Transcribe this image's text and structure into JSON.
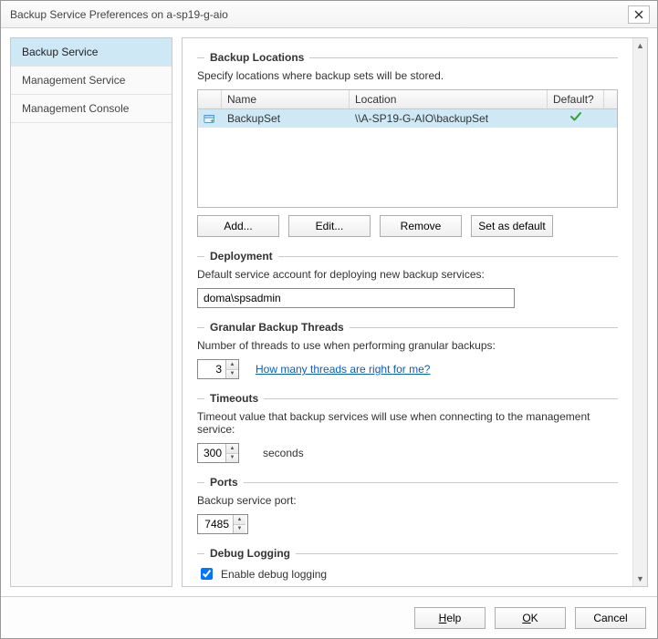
{
  "window": {
    "title": "Backup Service Preferences on a-sp19-g-aio"
  },
  "sidebar": {
    "items": [
      {
        "label": "Backup Service",
        "selected": true
      },
      {
        "label": "Management Service",
        "selected": false
      },
      {
        "label": "Management Console",
        "selected": false
      }
    ]
  },
  "sections": {
    "backup_locations": {
      "title": "Backup Locations",
      "desc": "Specify locations where backup sets will be stored.",
      "columns": {
        "name": "Name",
        "location": "Location",
        "default": "Default?"
      },
      "rows": [
        {
          "name": "BackupSet",
          "location": "\\\\A-SP19-G-AIO\\backupSet",
          "is_default": true
        }
      ],
      "buttons": {
        "add": "Add...",
        "edit": "Edit...",
        "remove": "Remove",
        "set_default": "Set as default"
      }
    },
    "deployment": {
      "title": "Deployment",
      "desc": "Default service account for deploying new backup services:",
      "value": "doma\\spsadmin"
    },
    "threads": {
      "title": "Granular Backup Threads",
      "desc": "Number of threads to use when performing granular backups:",
      "value": "3",
      "help_link": "How many threads are right for me?"
    },
    "timeouts": {
      "title": "Timeouts",
      "desc": "Timeout value that backup services will use when connecting to the management service:",
      "value": "300",
      "unit": "seconds"
    },
    "ports": {
      "title": "Ports",
      "desc": "Backup service port:",
      "value": "7485"
    },
    "debug": {
      "title": "Debug Logging",
      "checkbox_label": "Enable debug logging",
      "checked": true
    }
  },
  "footer": {
    "help": "Help",
    "ok": "OK",
    "cancel": "Cancel"
  }
}
